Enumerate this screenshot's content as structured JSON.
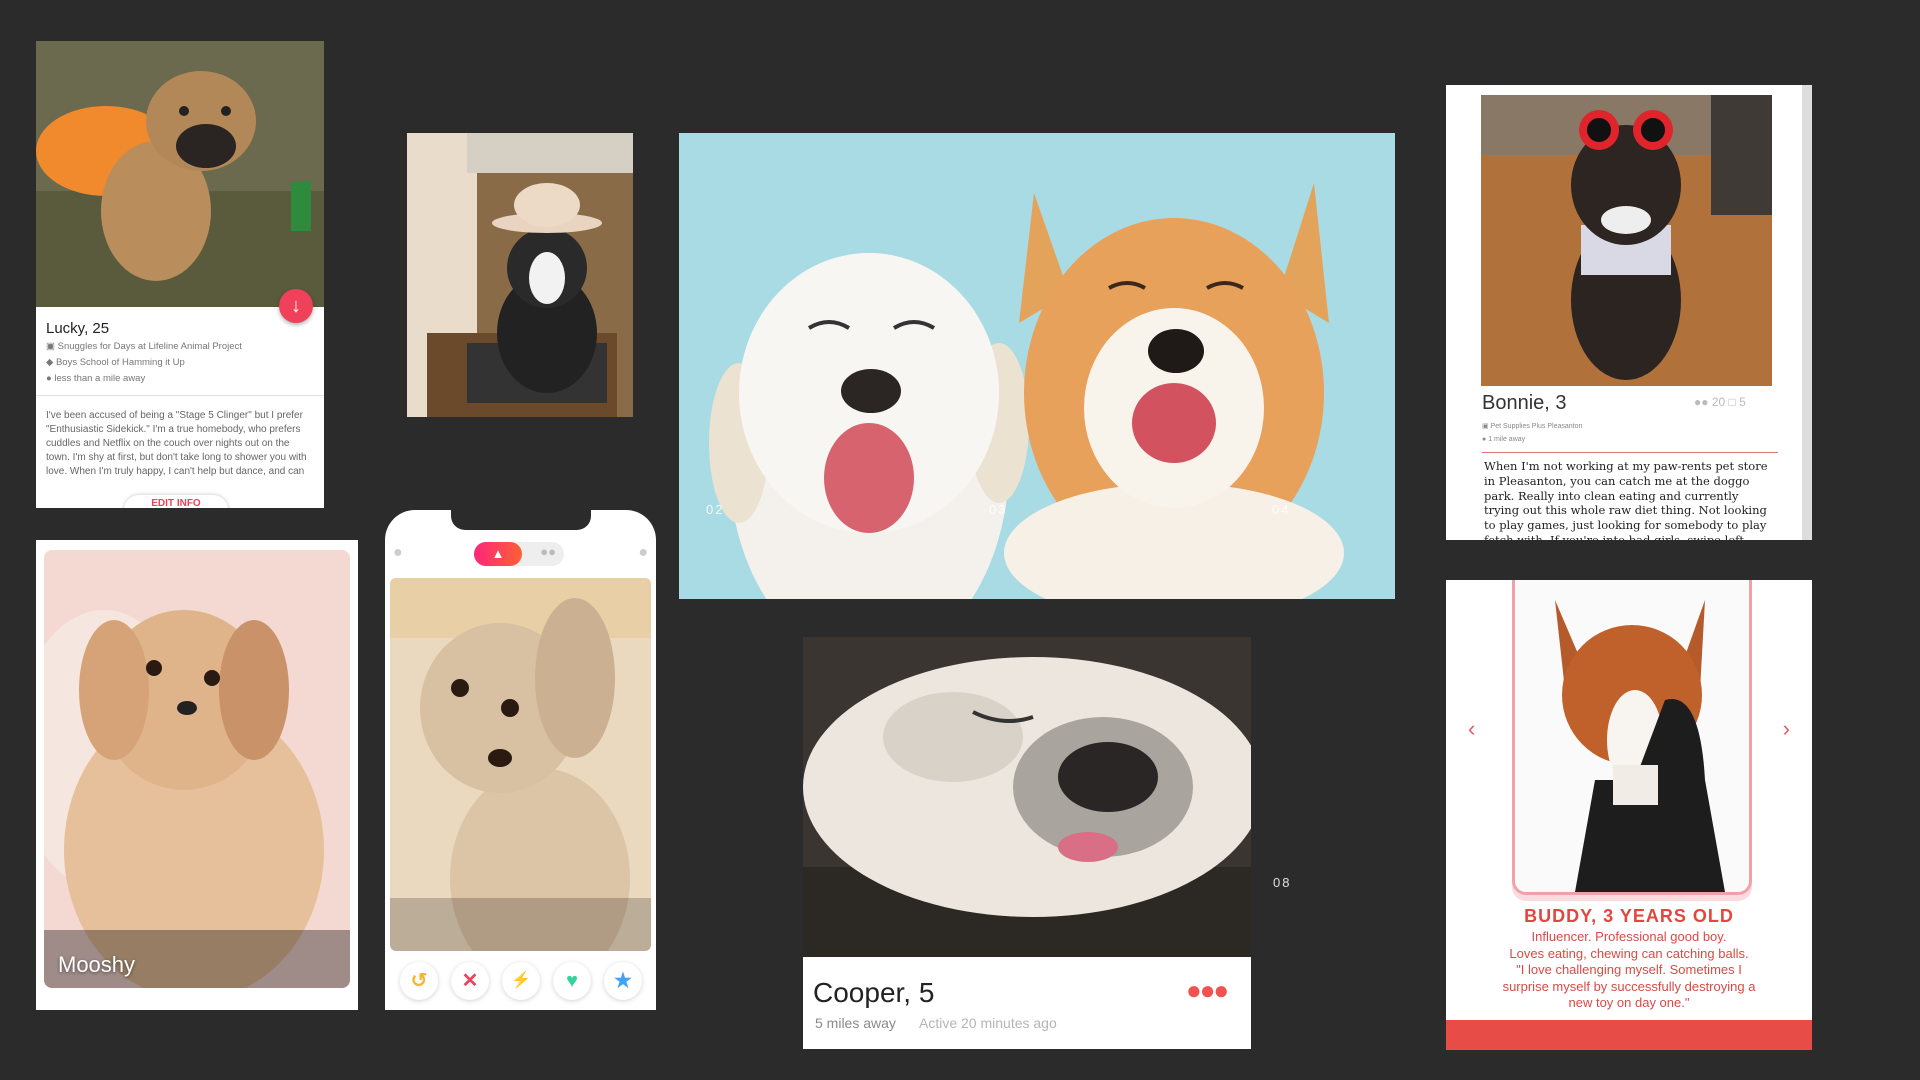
{
  "lucky": {
    "name": "Lucky, 25",
    "job": "Snuggles for Days at Lifeline Animal Project",
    "school": "Boys School of Hamming it Up",
    "distance": "less than a mile away",
    "bio": "I've been accused of being a \"Stage 5 Clinger\" but I prefer \"Enthusiastic Sidekick.\" I'm a true homebody, who prefers cuddles and Netflix on the couch over nights out on the town. I'm shy at first, but don't take long to shower you with love. When I'm truly happy, I can't help but dance, and can",
    "edit_label": "EDIT INFO"
  },
  "slides": {
    "n02": "02",
    "n03": "03",
    "n04": "04",
    "n08": "08"
  },
  "bonnie": {
    "name": "Bonnie, 3",
    "friends": "20",
    "likes": "5",
    "job": "Pet Supplies Plus Pleasanton",
    "distance": "1 mile away",
    "bio": "When I'm not working at my paw-rents pet store in Pleasanton, you can catch me at the doggo park. Really into clean eating and currently trying out this whole raw diet thing. Not looking to play games, just looking for somebody to play fetch with. If you're into bad girls, swipe left because I'm a good girl."
  },
  "mooshy": {
    "name": "Mooshy"
  },
  "cooper": {
    "name": "Cooper, 5",
    "distance": "5 miles away",
    "active": "Active 20 minutes ago"
  },
  "buddy": {
    "title": "BUDDY, 3 YEARS OLD",
    "line1": "Influencer. Professional good boy.",
    "line2": "Loves eating, chewing can catching balls.",
    "line3": "\"I love challenging myself. Sometimes I",
    "line4": "surprise myself by successfully destroying a",
    "line5": "new toy on day one.\""
  },
  "colors": {
    "accent": "#f0415a",
    "tinder_gradient_start": "#fd267a",
    "tinder_gradient_end": "#ff6036",
    "buddy_red": "#e2473f"
  }
}
